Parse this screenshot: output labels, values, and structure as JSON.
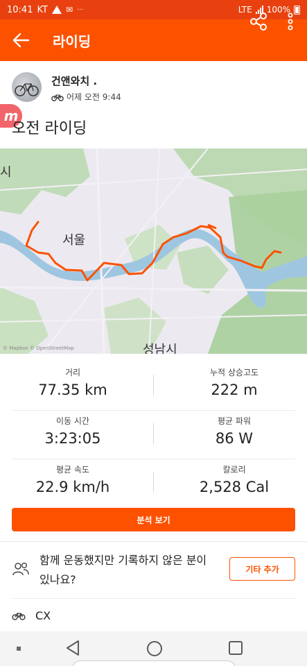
{
  "status_bar": {
    "time": "10:41",
    "carrier": "KT",
    "network": "LTE",
    "battery": "100%"
  },
  "header": {
    "title": "라이딩"
  },
  "athlete": {
    "name": "건앤와치 .",
    "time": "어제 오전 9:44"
  },
  "activity": {
    "title": "오전 라이딩",
    "badge": "m"
  },
  "map": {
    "labels": {
      "seoul": "서울",
      "seongnam": "성남시",
      "edge": "시"
    },
    "credit": "© Mapbox © OpenStreetMap"
  },
  "stats": [
    {
      "label": "거리",
      "value": "77.35 km"
    },
    {
      "label": "누적 상승고도",
      "value": "222 m"
    },
    {
      "label": "이동 시간",
      "value": "3:23:05"
    },
    {
      "label": "평균 파워",
      "value": "86 W"
    },
    {
      "label": "평균 속도",
      "value": "22.9 km/h"
    },
    {
      "label": "칼로리",
      "value": "2,528 Cal"
    }
  ],
  "analysis_button": "분석 보기",
  "prompt": {
    "text": "함께 운동했지만 기록하지 않은 분이 있나요?",
    "button": "기타 추가"
  },
  "gear": {
    "name": "CX"
  },
  "colors": {
    "brand": "#fc5200",
    "status_bar": "#e8410f",
    "route": "#fc5200"
  }
}
